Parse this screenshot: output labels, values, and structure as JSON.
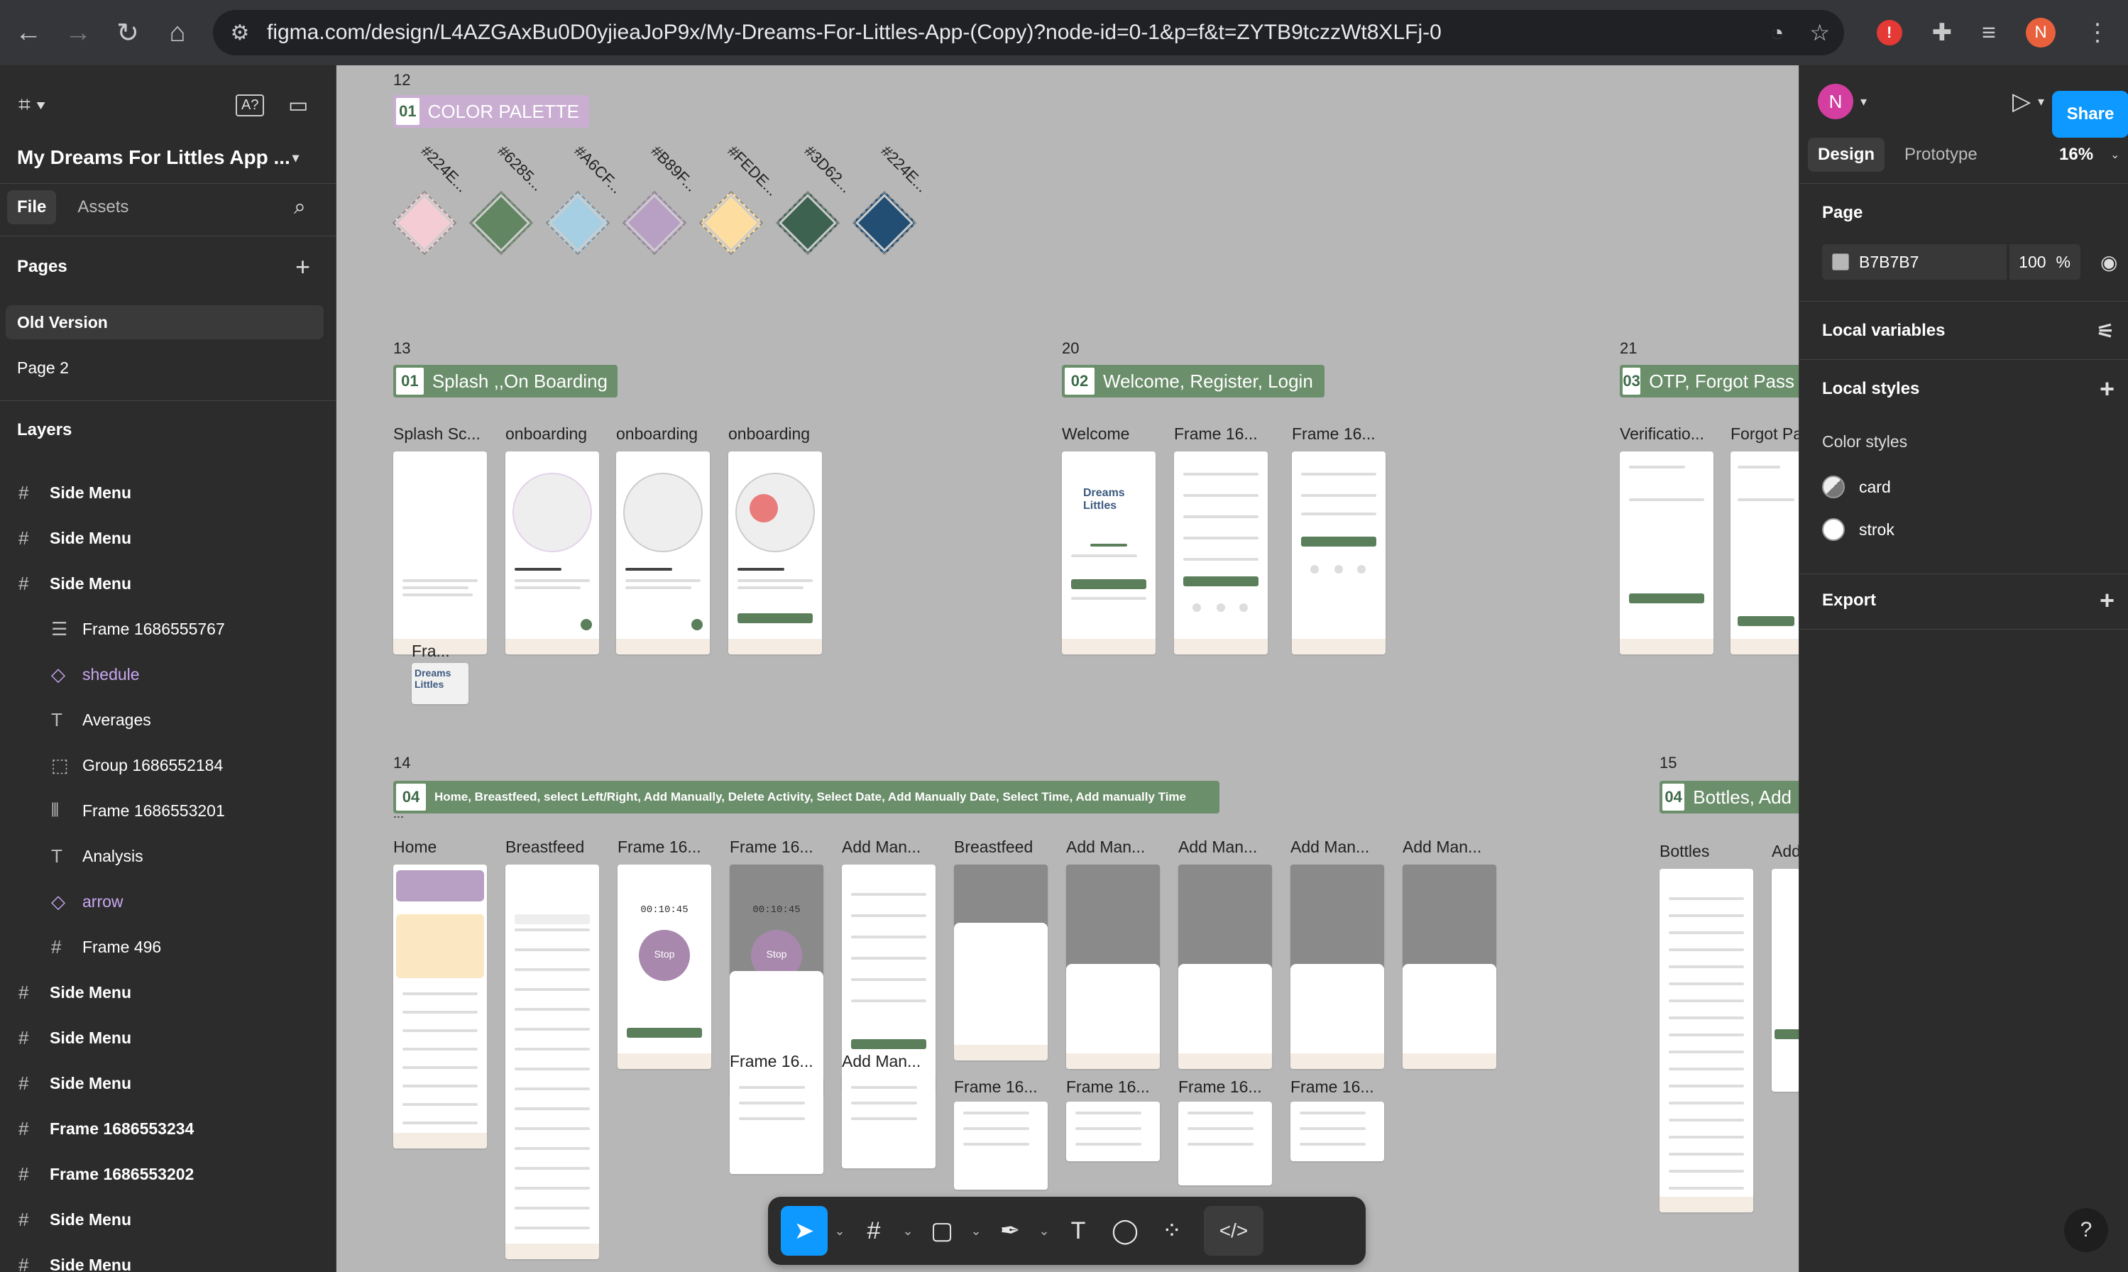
{
  "browser": {
    "url": "figma.com/design/L4AZGAxBu0D0yjieaJoP9x/My-Dreams-For-Littles-App-(Copy)?node-id=0-1&p=f&t=ZYTB9tczzWt8XLFj-0",
    "profile_initial": "N"
  },
  "left_panel": {
    "project_name": "My Dreams For Littles App ...",
    "tabs": [
      "File",
      "Assets"
    ],
    "pages_title": "Pages",
    "pages": [
      "Old Version",
      "Page 2"
    ],
    "layers_title": "Layers",
    "layers": [
      {
        "label": "Side Menu",
        "icon": "frame-icon"
      },
      {
        "label": "Side Menu",
        "icon": "frame-icon"
      },
      {
        "label": "Side Menu",
        "icon": "frame-icon"
      },
      {
        "label": "Frame 1686555767",
        "icon": "autolayout-icon"
      },
      {
        "label": "shedule",
        "icon": "component-instance-icon"
      },
      {
        "label": "Averages",
        "icon": "text-icon"
      },
      {
        "label": "Group 1686552184",
        "icon": "group-icon"
      },
      {
        "label": "Frame 1686553201",
        "icon": "autolayout-horizontal-icon"
      },
      {
        "label": "Analysis",
        "icon": "text-icon"
      },
      {
        "label": "arrow",
        "icon": "component-instance-icon"
      },
      {
        "label": "Frame 496",
        "icon": "frame-icon"
      },
      {
        "label": "Side Menu",
        "icon": "frame-icon"
      },
      {
        "label": "Side Menu",
        "icon": "frame-icon"
      },
      {
        "label": "Side Menu",
        "icon": "frame-icon"
      },
      {
        "label": "Frame 1686553234",
        "icon": "frame-icon"
      },
      {
        "label": "Frame 1686553202",
        "icon": "frame-icon"
      },
      {
        "label": "Side Menu",
        "icon": "frame-icon"
      },
      {
        "label": "Side Menu",
        "icon": "frame-icon"
      }
    ]
  },
  "canvas": {
    "sections": [
      {
        "number": "12",
        "badge": "01",
        "title": "COLOR PALETTE"
      },
      {
        "number": "13",
        "badge": "01",
        "title": "Splash ,,On Boarding"
      },
      {
        "number": "20",
        "badge": "02",
        "title": "Welcome, Register, Login"
      },
      {
        "number": "21",
        "badge": "03",
        "title": "OTP, Forgot Pass"
      },
      {
        "number": "14",
        "badge": "04",
        "title": "Home, Breastfeed, select Left/Right, Add Manually, Delete Activity, Select Date, Add Manually Date, Select Time, Add manually Time"
      },
      {
        "number": "15",
        "badge": "04",
        "title": "Bottles, Add"
      }
    ],
    "palette": [
      {
        "hex": "#224E...",
        "color": "#f4cdd4"
      },
      {
        "hex": "#6285...",
        "color": "#628562"
      },
      {
        "hex": "#A6CF...",
        "color": "#a6cfe4"
      },
      {
        "hex": "#B89F...",
        "color": "#b89fc4"
      },
      {
        "hex": "#FEDE...",
        "color": "#fedea0"
      },
      {
        "hex": "#3D62...",
        "color": "#3d6250"
      },
      {
        "hex": "#224E...",
        "color": "#224e73"
      }
    ],
    "frame_labels": {
      "splash": [
        "Splash Sc...",
        "onboarding",
        "onboarding",
        "onboarding",
        "Fra..."
      ],
      "welcome": [
        "Welcome",
        "Frame 16...",
        "Frame 16..."
      ],
      "otp": [
        "Verificatio...",
        "Forgot Pa"
      ],
      "home_row": [
        "Home",
        "Breastfeed",
        "Frame 16...",
        "Frame 16...",
        "Add Man...",
        "Breastfeed",
        "Add Man...",
        "Add Man...",
        "Add Man...",
        "Add Man..."
      ],
      "home_row2": [
        "Frame 16...",
        "Add Man...",
        "Frame 16...",
        "Frame 16...",
        "Frame 16...",
        "Frame 16..."
      ],
      "bottles": [
        "Bottles",
        "Add"
      ],
      "misc": [
        "..."
      ]
    },
    "mini_text": {
      "timer": "00:10:45",
      "stop": "Stop",
      "logo": "Dreams Littles"
    }
  },
  "toolbar": {
    "tools": [
      "move-tool",
      "frame-tool",
      "shape-tool",
      "pen-tool",
      "text-tool",
      "comment-tool",
      "actions-tool",
      "dev-mode-toggle"
    ]
  },
  "right_panel": {
    "share_label": "Share",
    "tabs": [
      "Design",
      "Prototype"
    ],
    "zoom": "16%",
    "page_title": "Page",
    "page_color": "B7B7B7",
    "page_opacity": "100",
    "percent": "%",
    "local_variables": "Local variables",
    "local_styles": "Local styles",
    "color_styles_title": "Color styles",
    "color_styles": [
      {
        "name": "card",
        "color": "#9e9e9e"
      },
      {
        "name": "strok",
        "color": "#ffffff"
      }
    ],
    "export": "Export",
    "help": "?"
  }
}
